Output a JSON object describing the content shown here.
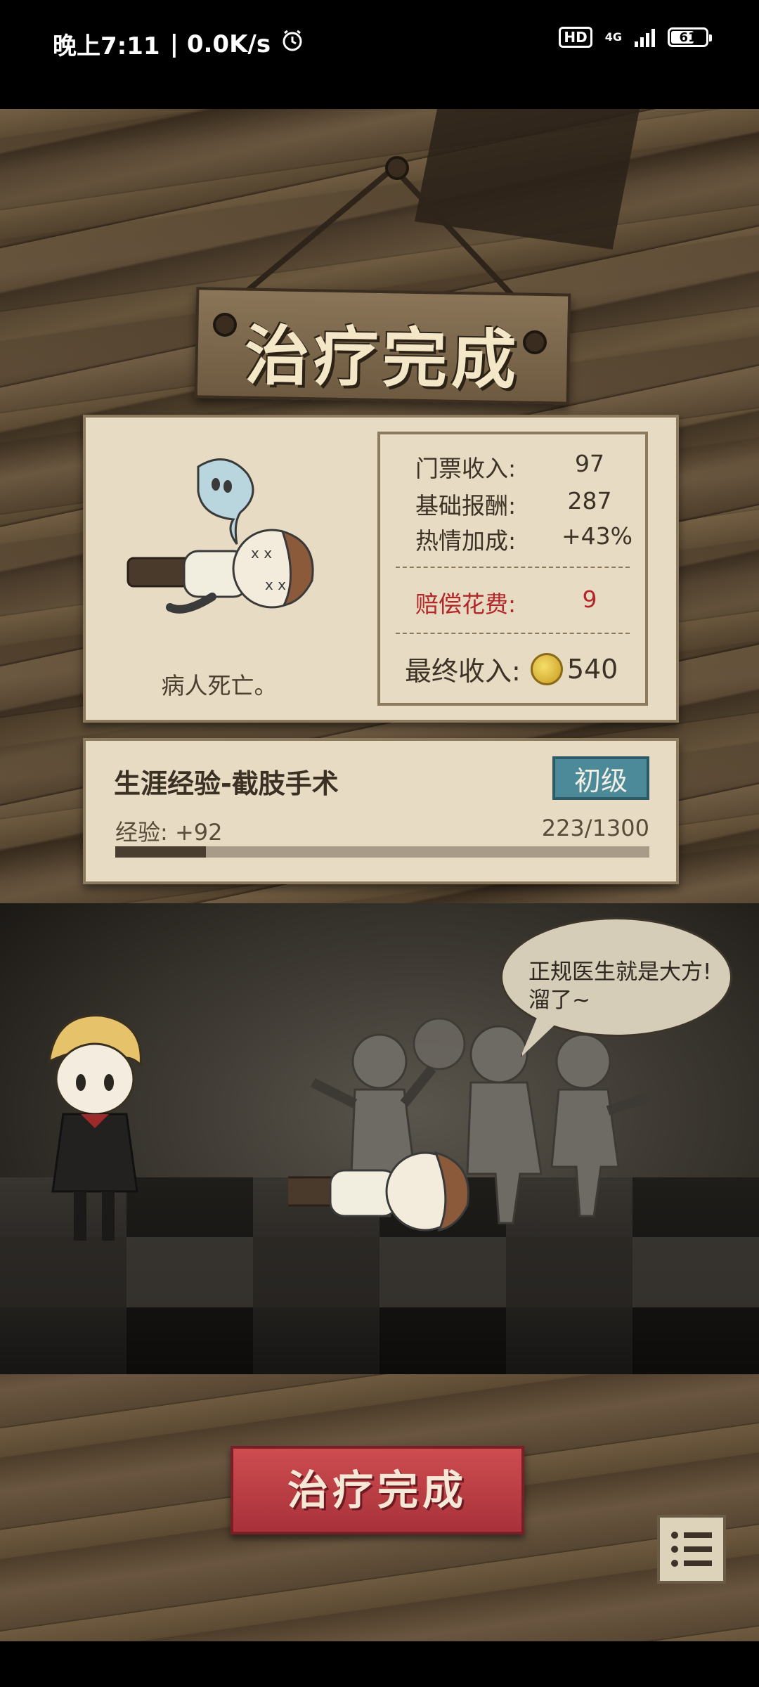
{
  "status_bar": {
    "time": "晚上7:11",
    "speed": "| 0.0K/s",
    "hd": "HD",
    "network": "4G",
    "battery": "61"
  },
  "header": {
    "sign_title": "治疗完成"
  },
  "result": {
    "death_text": "病人死亡。",
    "stats": [
      {
        "label": "门票收入:",
        "value": "97"
      },
      {
        "label": "基础报酬:",
        "value": "287"
      },
      {
        "label": "热情加成:",
        "value": "+43%"
      }
    ],
    "penalty": {
      "label": "赔偿花费:",
      "value": "9"
    },
    "final": {
      "label": "最终收入:",
      "value": "540"
    }
  },
  "career": {
    "title": "生涯经验-截肢手术",
    "level": "初级",
    "exp_label": "经验: +92",
    "exp_count": "223/1300",
    "progress_fraction": 0.17
  },
  "scene": {
    "speech": "正规医生就是大方!溜了~"
  },
  "actions": {
    "done_label": "治疗完成",
    "menu_icon": "list-icon"
  }
}
